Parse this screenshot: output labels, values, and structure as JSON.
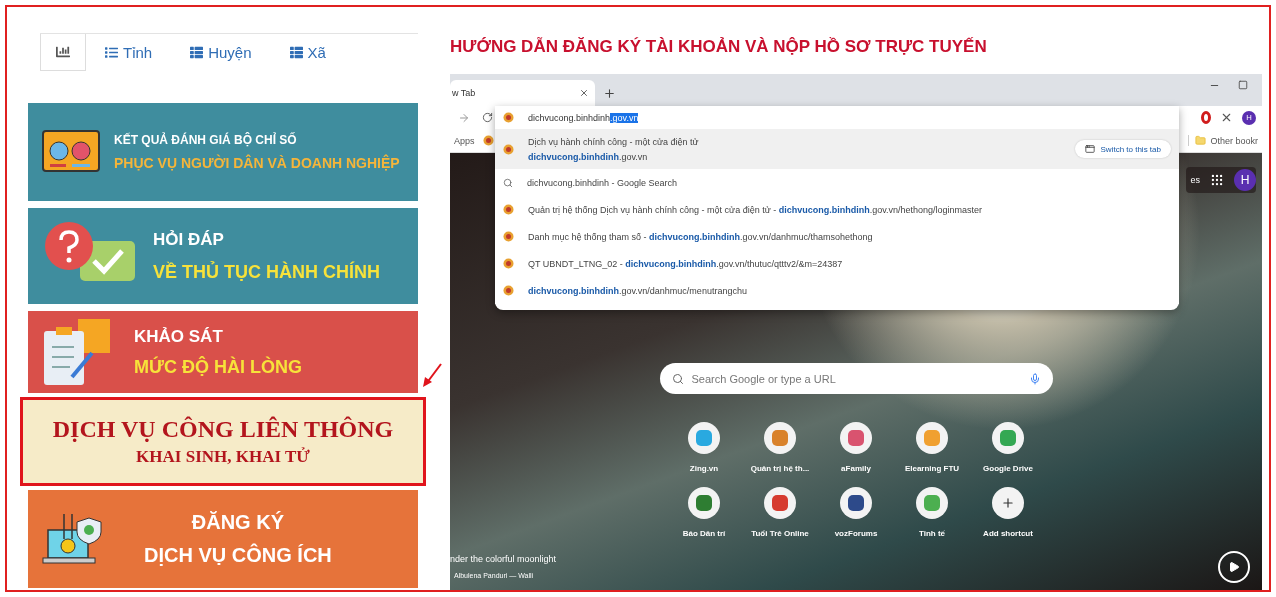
{
  "tabs": [
    {
      "kind": "chart",
      "selected": true
    },
    {
      "kind": "list",
      "label": "Tỉnh",
      "selected": false
    },
    {
      "kind": "table",
      "label": "Huyện",
      "selected": false
    },
    {
      "kind": "table",
      "label": "Xã",
      "selected": false
    }
  ],
  "cards": [
    {
      "kind": "dashboard",
      "line1": "KẾT QUẢ ĐÁNH GIÁ BỘ CHỈ SỐ",
      "line2": "PHỤC VỤ NGƯỜI DÂN VÀ DOANH NGHIỆP",
      "color": "#3f8d9e",
      "highlighted": false
    },
    {
      "kind": "question",
      "line1": "HỎI ĐÁP",
      "line2": "VỀ THỦ TỤC HÀNH CHÍNH",
      "color": "#3f8d9e",
      "highlighted": false
    },
    {
      "kind": "survey",
      "line1": "KHẢO SÁT",
      "line2": "MỨC ĐỘ HÀI LÒNG",
      "color": "#d9504a",
      "highlighted": false
    },
    {
      "kind": "banner",
      "line1": "DỊCH VỤ CÔNG LIÊN THÔNG",
      "line2": "KHAI SINH, KHAI TỬ",
      "color": "#f6ebc8",
      "highlighted": true
    },
    {
      "kind": "utility",
      "line1": "ĐĂNG KÝ",
      "line2": "DỊCH VỤ CÔNG ÍCH",
      "color": "#e6733a",
      "highlighted": false
    }
  ],
  "guide_title": "HƯỚNG DẪN ĐĂNG KÝ TÀI KHOẢN VÀ NỘP HỒ SƠ TRỰC TUYẾN",
  "browser": {
    "tab_title": "w Tab",
    "omnibox": {
      "typed": "dichvucong.binhdinh",
      "selection": ".gov.vn"
    },
    "suggestions": [
      {
        "kind": "site",
        "text": "Dịch vụ hành chính công - một cửa điện tử",
        "url": "**dichvucong.binhdinh**.gov.vn",
        "action": "Switch to this tab",
        "selected": true
      },
      {
        "kind": "search",
        "text": "dichvucong.binhdinh - Google Search",
        "selected": false
      },
      {
        "kind": "site",
        "text": "Quản trị hệ thống Dịch vụ hành chính công - một cửa điện tử - **dichvucong.binhdinh**.gov.vn/hethong/loginmaster",
        "selected": false
      },
      {
        "kind": "site",
        "text": "Danh mục hệ thống tham số - **dichvucong.binhdinh**.gov.vn/danhmuc/thamsohethong",
        "selected": false
      },
      {
        "kind": "site",
        "text": "QT UBNDT_LTNG_02 - **dichvucong.binhdinh**.gov.vn/thutuc/qtttv2/&m=24387",
        "selected": false
      },
      {
        "kind": "site",
        "text": "**dichvucong.binhdinh**.gov.vn/danhmuc/menutrangchu",
        "selected": false
      }
    ],
    "bookmarks": {
      "apps": "Apps",
      "other": "Other bookr"
    },
    "top_link": "es",
    "toolbar_avatar": "H",
    "page_avatar": "H",
    "search_placeholder": "Search Google or type a URL",
    "shortcuts": [
      {
        "kind": "site",
        "label": "Zing.vn",
        "color": "#29a9e0"
      },
      {
        "kind": "site",
        "label": "Quản trị hệ th...",
        "color": "#d9822b"
      },
      {
        "kind": "site",
        "label": "aFamily",
        "color": "#d9536f"
      },
      {
        "kind": "site",
        "label": "Elearning FTU",
        "color": "#f0a030"
      },
      {
        "kind": "site",
        "label": "Google Drive",
        "color": "#34a853"
      },
      {
        "kind": "site",
        "label": "Báo Dân trí",
        "color": "#2e7d32"
      },
      {
        "kind": "site",
        "label": "Tuổi Trẻ Online",
        "color": "#d63b2f"
      },
      {
        "kind": "site",
        "label": "vozForums",
        "color": "#2d4a8a"
      },
      {
        "kind": "site",
        "label": "Tinh tế",
        "color": "#4caf50"
      },
      {
        "kind": "add",
        "label": "Add shortcut"
      }
    ],
    "credit": {
      "title": "nder the colorful moonlight",
      "author": "Albulena Panduri — Walli"
    }
  }
}
